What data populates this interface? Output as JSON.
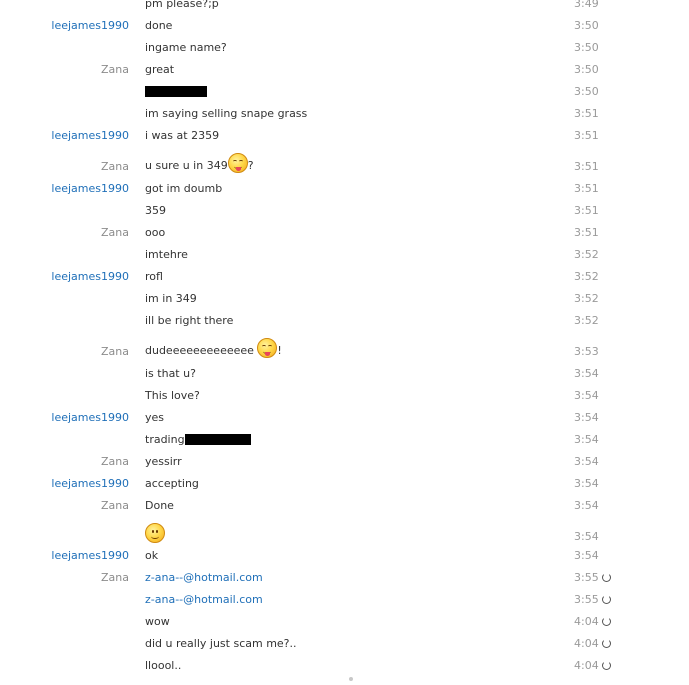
{
  "messages": [
    {
      "sender": "",
      "text": "pm please?;p",
      "time": "3:49"
    },
    {
      "sender": "leejames1990",
      "text": "done",
      "time": "3:50"
    },
    {
      "sender": "",
      "text": "ingame name?",
      "time": "3:50"
    },
    {
      "sender": "Zana",
      "text": "great",
      "time": "3:50"
    },
    {
      "sender": "",
      "text": "",
      "time": "3:50"
    },
    {
      "sender": "",
      "text": "im saying selling snape grass",
      "time": "3:51"
    },
    {
      "sender": "leejames1990",
      "text": "i was at 2359",
      "time": "3:51"
    },
    {
      "sender": "Zana",
      "text": "u sure u in 349",
      "text_after": "?",
      "time": "3:51"
    },
    {
      "sender": "leejames1990",
      "text": "got im doumb",
      "time": "3:51"
    },
    {
      "sender": "",
      "text": "359",
      "time": "3:51"
    },
    {
      "sender": "Zana",
      "text": "ooo",
      "time": "3:51"
    },
    {
      "sender": "",
      "text": "imtehre",
      "time": "3:52"
    },
    {
      "sender": "leejames1990",
      "text": "rofl",
      "time": "3:52"
    },
    {
      "sender": "",
      "text": "im in 349",
      "time": "3:52"
    },
    {
      "sender": "",
      "text": "ill be right there",
      "time": "3:52"
    },
    {
      "sender": "Zana",
      "text": "dudeeeeeeeeeeeee",
      "text_after": "!",
      "time": "3:53"
    },
    {
      "sender": "",
      "text": "is that u?",
      "time": "3:54"
    },
    {
      "sender": "",
      "text": "This love?",
      "time": "3:54"
    },
    {
      "sender": "leejames1990",
      "text": "yes",
      "time": "3:54"
    },
    {
      "sender": "",
      "text": "trading",
      "time": "3:54"
    },
    {
      "sender": "Zana",
      "text": "yessirr",
      "time": "3:54"
    },
    {
      "sender": "leejames1990",
      "text": "accepting",
      "time": "3:54"
    },
    {
      "sender": "Zana",
      "text": "Done",
      "time": "3:54"
    },
    {
      "sender": "",
      "text": "",
      "time": "3:54"
    },
    {
      "sender": "leejames1990",
      "text": "ok",
      "time": "3:54"
    },
    {
      "sender": "Zana",
      "text": "z-ana--@hotmail.com",
      "time": "3:55"
    },
    {
      "sender": "",
      "text": "z-ana--@hotmail.com",
      "time": "3:55"
    },
    {
      "sender": "",
      "text": "wow",
      "time": "4:04"
    },
    {
      "sender": "",
      "text": "did u really just scam me?..",
      "time": "4:04"
    },
    {
      "sender": "",
      "text": "lloool..",
      "time": "4:04"
    }
  ],
  "colors": {
    "sender_lee": "#1f6fb8",
    "sender_zana": "#8c8c8c",
    "link": "#1f6fb8",
    "time": "#9a9a9a"
  },
  "icons": {
    "tongue_emoji": "tongue-out-smiley-icon",
    "smile_emoji": "smiley-face-icon",
    "pending": "sending-spinner-icon"
  }
}
